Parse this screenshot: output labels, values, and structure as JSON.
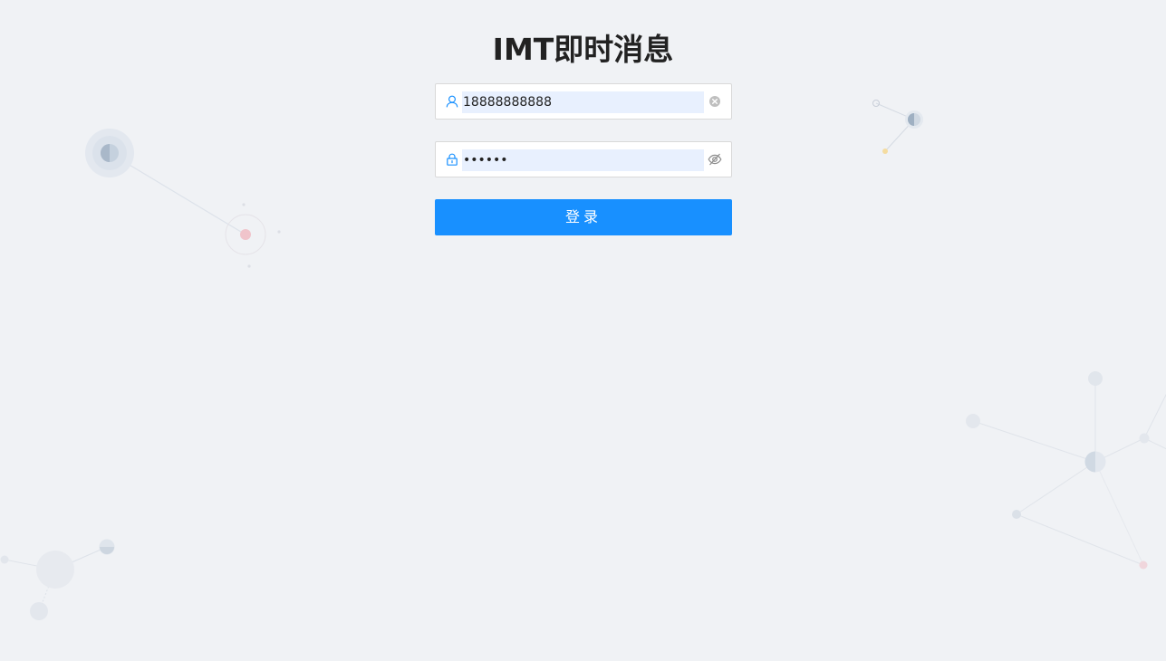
{
  "app": {
    "title": "IMT即时消息"
  },
  "login_form": {
    "username": {
      "value": "18888888888",
      "icon": "user-icon",
      "clear_icon": "clear-circle-icon"
    },
    "password": {
      "value": "••••••",
      "icon": "lock-icon",
      "toggle_icon": "eye-invisible-icon"
    },
    "submit_label": "登录"
  },
  "colors": {
    "background": "#f0f2f5",
    "primary": "#1890ff",
    "autofill": "#e8f0fe",
    "title": "#222222"
  }
}
